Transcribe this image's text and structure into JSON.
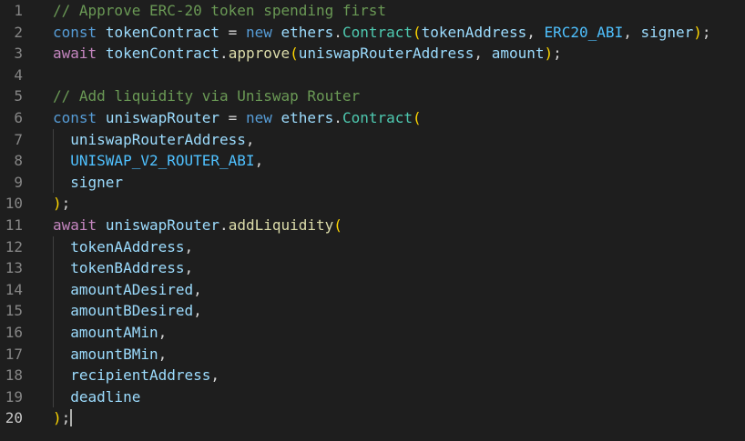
{
  "editor": {
    "active_line": 20,
    "line_numbers": [
      "1",
      "2",
      "3",
      "4",
      "5",
      "6",
      "7",
      "8",
      "9",
      "10",
      "11",
      "12",
      "13",
      "14",
      "15",
      "16",
      "17",
      "18",
      "19",
      "20"
    ],
    "colors": {
      "background": "#1e1e1e",
      "line_number": "#858585",
      "line_number_active": "#c6c6c6",
      "comment": "#6a9955",
      "keyword": "#569cd6",
      "control": "#c586c0",
      "variable": "#9cdcfe",
      "constant": "#4fc1ff",
      "function": "#dcdcaa",
      "class": "#4ec9b0",
      "bracket": "#ffd700",
      "text": "#d4d4d4"
    },
    "lines": [
      [
        [
          "t-comment",
          "// Approve ERC-20 token spending first"
        ]
      ],
      [
        [
          "t-keyword",
          "const"
        ],
        [
          "t-op",
          " "
        ],
        [
          "t-var",
          "tokenContract"
        ],
        [
          "t-op",
          " = "
        ],
        [
          "t-keyword",
          "new"
        ],
        [
          "t-op",
          " "
        ],
        [
          "t-var",
          "ethers"
        ],
        [
          "t-punc",
          "."
        ],
        [
          "t-class",
          "Contract"
        ],
        [
          "t-paren",
          "("
        ],
        [
          "t-var",
          "tokenAddress"
        ],
        [
          "t-punc",
          ", "
        ],
        [
          "t-const",
          "ERC20_ABI"
        ],
        [
          "t-punc",
          ", "
        ],
        [
          "t-var",
          "signer"
        ],
        [
          "t-paren",
          ")"
        ],
        [
          "t-punc",
          ";"
        ]
      ],
      [
        [
          "t-control",
          "await"
        ],
        [
          "t-op",
          " "
        ],
        [
          "t-var",
          "tokenContract"
        ],
        [
          "t-punc",
          "."
        ],
        [
          "t-func",
          "approve"
        ],
        [
          "t-paren",
          "("
        ],
        [
          "t-var",
          "uniswapRouterAddress"
        ],
        [
          "t-punc",
          ", "
        ],
        [
          "t-var",
          "amount"
        ],
        [
          "t-paren",
          ")"
        ],
        [
          "t-punc",
          ";"
        ]
      ],
      [],
      [
        [
          "t-comment",
          "// Add liquidity via Uniswap Router"
        ]
      ],
      [
        [
          "t-keyword",
          "const"
        ],
        [
          "t-op",
          " "
        ],
        [
          "t-var",
          "uniswapRouter"
        ],
        [
          "t-op",
          " = "
        ],
        [
          "t-keyword",
          "new"
        ],
        [
          "t-op",
          " "
        ],
        [
          "t-var",
          "ethers"
        ],
        [
          "t-punc",
          "."
        ],
        [
          "t-class",
          "Contract"
        ],
        [
          "t-paren",
          "("
        ]
      ],
      [
        [
          "t-op",
          "  "
        ],
        [
          "t-var",
          "uniswapRouterAddress"
        ],
        [
          "t-punc",
          ","
        ]
      ],
      [
        [
          "t-op",
          "  "
        ],
        [
          "t-const",
          "UNISWAP_V2_ROUTER_ABI"
        ],
        [
          "t-punc",
          ","
        ]
      ],
      [
        [
          "t-op",
          "  "
        ],
        [
          "t-var",
          "signer"
        ]
      ],
      [
        [
          "t-paren",
          ")"
        ],
        [
          "t-punc",
          ";"
        ]
      ],
      [
        [
          "t-control",
          "await"
        ],
        [
          "t-op",
          " "
        ],
        [
          "t-var",
          "uniswapRouter"
        ],
        [
          "t-punc",
          "."
        ],
        [
          "t-func",
          "addLiquidity"
        ],
        [
          "t-paren",
          "("
        ]
      ],
      [
        [
          "t-op",
          "  "
        ],
        [
          "t-var",
          "tokenAAddress"
        ],
        [
          "t-punc",
          ","
        ]
      ],
      [
        [
          "t-op",
          "  "
        ],
        [
          "t-var",
          "tokenBAddress"
        ],
        [
          "t-punc",
          ","
        ]
      ],
      [
        [
          "t-op",
          "  "
        ],
        [
          "t-var",
          "amountADesired"
        ],
        [
          "t-punc",
          ","
        ]
      ],
      [
        [
          "t-op",
          "  "
        ],
        [
          "t-var",
          "amountBDesired"
        ],
        [
          "t-punc",
          ","
        ]
      ],
      [
        [
          "t-op",
          "  "
        ],
        [
          "t-var",
          "amountAMin"
        ],
        [
          "t-punc",
          ","
        ]
      ],
      [
        [
          "t-op",
          "  "
        ],
        [
          "t-var",
          "amountBMin"
        ],
        [
          "t-punc",
          ","
        ]
      ],
      [
        [
          "t-op",
          "  "
        ],
        [
          "t-var",
          "recipientAddress"
        ],
        [
          "t-punc",
          ","
        ]
      ],
      [
        [
          "t-op",
          "  "
        ],
        [
          "t-var",
          "deadline"
        ]
      ],
      [
        [
          "t-paren",
          ")"
        ],
        [
          "t-punc",
          ";"
        ]
      ]
    ]
  }
}
